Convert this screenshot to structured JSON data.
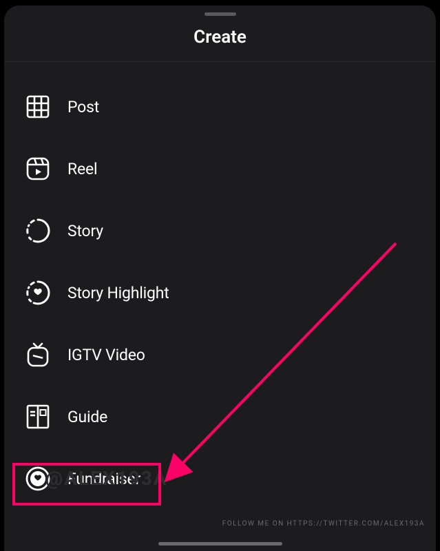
{
  "header": {
    "title": "Create"
  },
  "items": [
    {
      "label": "Post",
      "icon": "grid-icon"
    },
    {
      "label": "Reel",
      "icon": "reel-icon"
    },
    {
      "label": "Story",
      "icon": "story-icon"
    },
    {
      "label": "Story Highlight",
      "icon": "story-highlight-icon"
    },
    {
      "label": "IGTV Video",
      "icon": "igtv-icon"
    },
    {
      "label": "Guide",
      "icon": "guide-icon"
    },
    {
      "label": "Fundraiser",
      "icon": "fundraiser-icon"
    }
  ],
  "annotation": {
    "highlight_color": "#ff0066"
  },
  "watermark": "@ALEX193A",
  "credit": "FOLLOW ME ON HTTPS://TWITTER.COM/ALEX193A"
}
